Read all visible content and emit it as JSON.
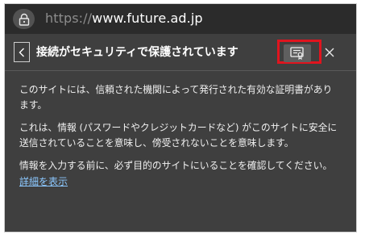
{
  "address_bar": {
    "url_scheme": "https://",
    "url_host": "www.future.ad.jp",
    "lock_icon": "lock-icon"
  },
  "panel": {
    "title": "接続がセキュリティで保護されています",
    "back_icon": "chevron-left-icon",
    "certificate_icon": "certificate-icon",
    "close_icon": "close-icon",
    "highlight_color": "#e0141e"
  },
  "content": {
    "paragraph1": "このサイトには、信頼された機関によって発行された有効な証明書があります。",
    "paragraph2": "これは、情報 (パスワードやクレジットカードなど) がこのサイトに安全に送信されていることを意味し、傍受されないことを意味します。",
    "paragraph3": "情報を入力する前に、必ず目的のサイトにいることを確認してください。",
    "details_link": "詳細を表示"
  }
}
